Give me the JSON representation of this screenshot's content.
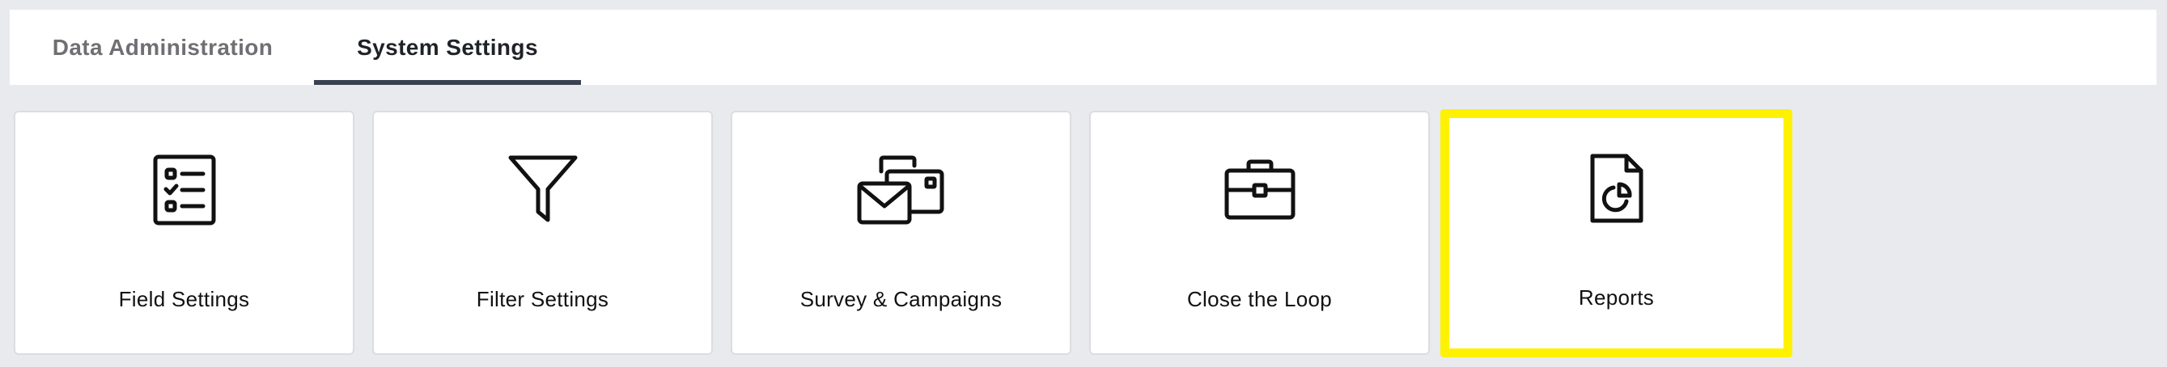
{
  "tabs": [
    {
      "label": "Data Administration",
      "active": false
    },
    {
      "label": "System Settings",
      "active": true
    }
  ],
  "cards": [
    {
      "label": "Field Settings",
      "icon": "checklist-icon"
    },
    {
      "label": "Filter Settings",
      "icon": "funnel-filter-icon"
    },
    {
      "label": "Survey & Campaigns",
      "icon": "mail-cards-icon"
    },
    {
      "label": "Close the Loop",
      "icon": "briefcase-icon"
    },
    {
      "label": "Reports",
      "icon": "report-document-icon",
      "highlighted": true
    }
  ],
  "colors": {
    "page_background": "#e9eaee",
    "active_tab_underline": "#3a4150",
    "highlight_border": "#fff200",
    "inactive_tab_text": "#6f7073",
    "active_tab_text": "#1f2227"
  }
}
